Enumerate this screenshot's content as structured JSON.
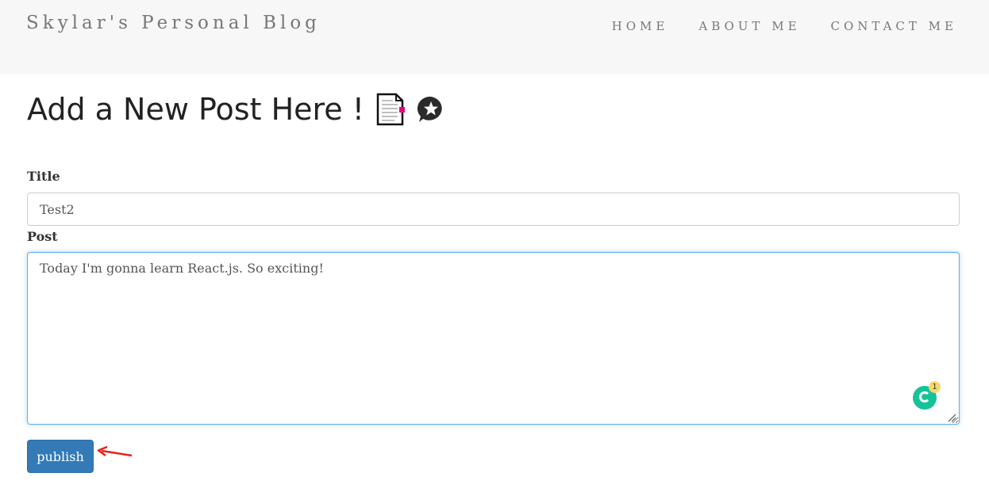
{
  "header": {
    "brand": "Skylar's Personal Blog",
    "nav": [
      {
        "label": "HOME"
      },
      {
        "label": "ABOUT ME"
      },
      {
        "label": "CONTACT ME"
      }
    ]
  },
  "main": {
    "page_title": "Add a New Post Here !",
    "title_label": "Title",
    "title_value": "Test2",
    "post_label": "Post",
    "post_value": "Today I'm gonna learn React.js. So exciting!",
    "publish_label": "publish"
  },
  "grammarly": {
    "badge_count": "1",
    "color": "#15c39a"
  },
  "icons": [
    "document-icon",
    "star-speech-bubble-icon",
    "grammarly-icon",
    "resize-handle-icon",
    "red-arrow-annotation"
  ],
  "colors": {
    "navbar_bg": "#f7f7f7",
    "primary_button": "#337ab7",
    "focus_border": "#66afe9",
    "annotation_arrow": "#e8231d"
  }
}
